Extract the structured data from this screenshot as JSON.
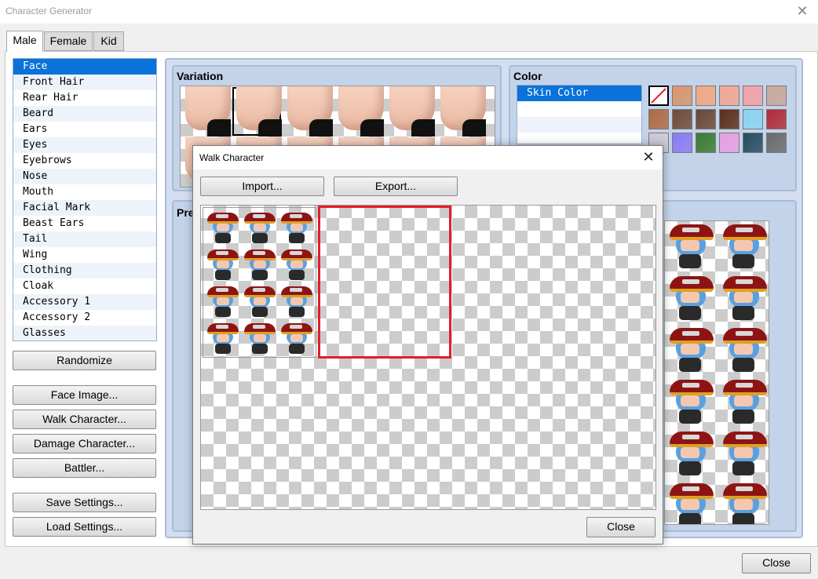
{
  "window": {
    "title": "Character Generator"
  },
  "tabs": [
    {
      "label": "Male",
      "active": true
    },
    {
      "label": "Female",
      "active": false
    },
    {
      "label": "Kid",
      "active": false
    }
  ],
  "parts": [
    "Face",
    "Front Hair",
    "Rear Hair",
    "Beard",
    "Ears",
    "Eyes",
    "Eyebrows",
    "Nose",
    "Mouth",
    "Facial Mark",
    "Beast Ears",
    "Tail",
    "Wing",
    "Clothing",
    "Cloak",
    "Accessory 1",
    "Accessory 2",
    "Glasses"
  ],
  "parts_selected_index": 0,
  "buttons": {
    "randomize": "Randomize",
    "face_image": "Face Image...",
    "walk_character": "Walk Character...",
    "damage_character": "Damage Character...",
    "battler": "Battler...",
    "save_settings": "Save Settings...",
    "load_settings": "Load Settings...",
    "close": "Close"
  },
  "variation": {
    "label": "Variation",
    "selected_index": 1
  },
  "color": {
    "label": "Color",
    "items": [
      "Skin Color"
    ],
    "swatches": [
      "none",
      "#d9956b",
      "#f0a880",
      "#f2a694",
      "#f3a0a8",
      "#c9a89a",
      "#b06a44",
      "#6e4a36",
      "#6a4632",
      "#5a2e18",
      "#8ad4f2",
      "#b02a38",
      "#d0c8d6",
      "#8a7af2",
      "#3a7a30",
      "#e7a0e2",
      "#244a5e",
      "#6a6a6a"
    ]
  },
  "preview": {
    "label": "Pre"
  },
  "dialog": {
    "title": "Walk Character",
    "import_label": "Import...",
    "export_label": "Export...",
    "close_label": "Close"
  },
  "colors": {
    "selection": "#0a72d8",
    "highlight_box": "#e01f2b",
    "group_bg": "#c3d3ea"
  }
}
